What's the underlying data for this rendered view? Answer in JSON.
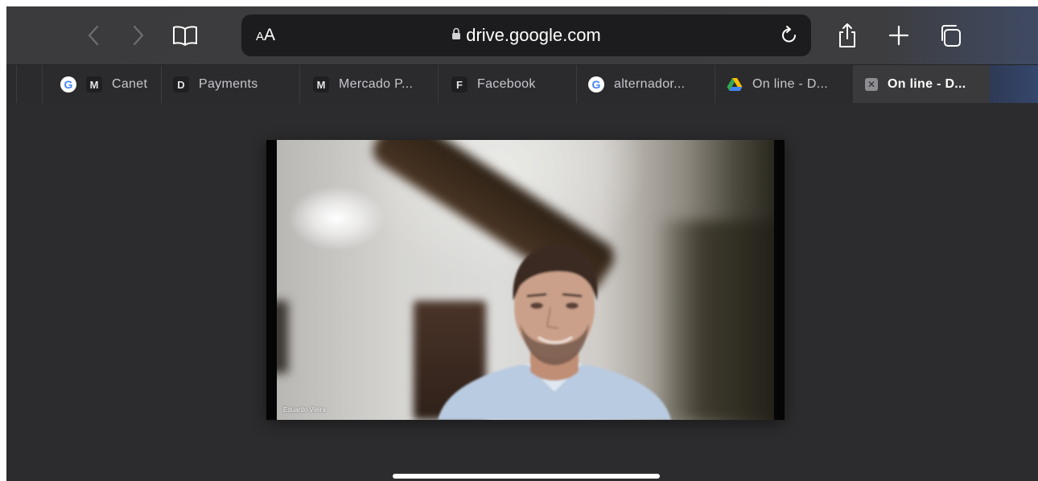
{
  "toolbar": {
    "reader_small": "A",
    "reader_big": "A",
    "url": "drive.google.com"
  },
  "tabs": [
    {
      "favicon": "google-icon",
      "favicon_text": "G",
      "label": ""
    },
    {
      "favicon": "letter-icon",
      "favicon_text": "M",
      "label": "Canet"
    },
    {
      "favicon": "letter-icon",
      "favicon_text": "D",
      "label": "Payments"
    },
    {
      "favicon": "letter-icon",
      "favicon_text": "M",
      "label": "Mercado P..."
    },
    {
      "favicon": "letter-icon",
      "favicon_text": "F",
      "label": "Facebook"
    },
    {
      "favicon": "google-icon",
      "favicon_text": "G",
      "label": "alternador..."
    },
    {
      "favicon": "drive-icon",
      "favicon_text": "",
      "label": "On line - D..."
    },
    {
      "favicon": "close-icon",
      "favicon_text": "✕",
      "label": "On line - D...",
      "active": true
    }
  ],
  "video": {
    "participant_name": "Eduardo Vieira"
  },
  "colors": {
    "background": "#2c2c2e",
    "toolbar": "#3b3b3d",
    "address_bar": "#1c1c1e",
    "active_tab": "#3a3a3c"
  }
}
